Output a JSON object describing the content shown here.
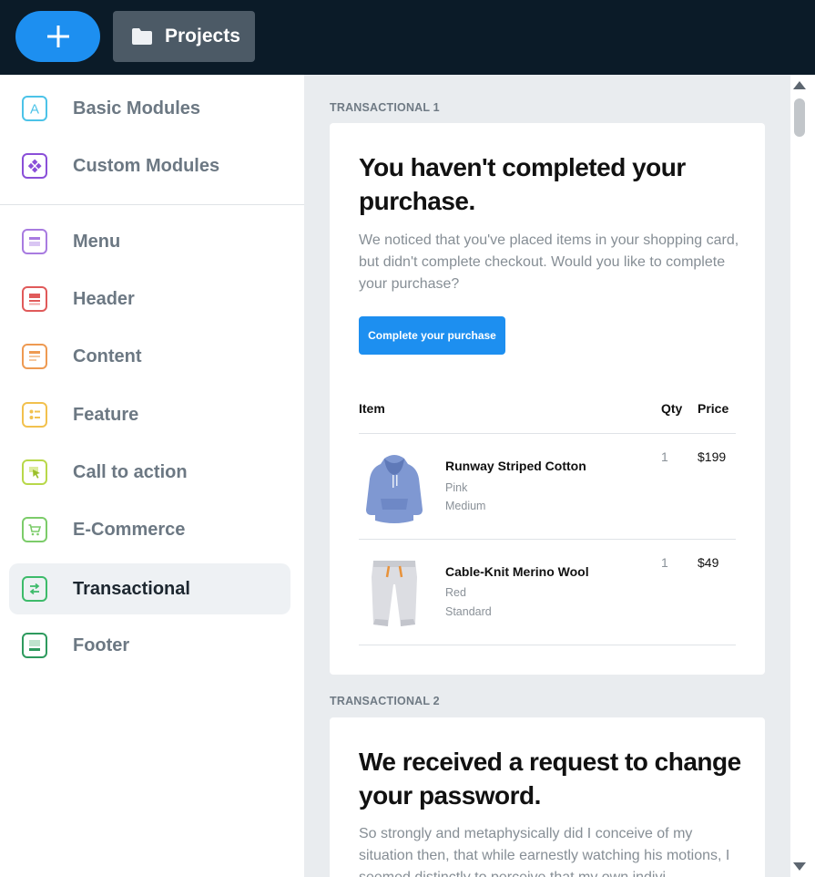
{
  "topbar": {
    "add_icon": "plus-icon",
    "projects_label": "Projects",
    "projects_icon": "folder-icon"
  },
  "sidebar": {
    "items": [
      {
        "label": "Basic Modules",
        "icon": "letter-a-icon",
        "color": "#4cc3e8"
      },
      {
        "label": "Custom Modules",
        "icon": "custom-module-icon",
        "color": "#8a4fd8"
      },
      {
        "label": "Menu",
        "icon": "menu-block-icon",
        "color": "#a87be0"
      },
      {
        "label": "Header",
        "icon": "header-block-icon",
        "color": "#e05a5a"
      },
      {
        "label": "Content",
        "icon": "content-block-icon",
        "color": "#ee9a52"
      },
      {
        "label": "Feature",
        "icon": "feature-block-icon",
        "color": "#f2c14e"
      },
      {
        "label": "Call to action",
        "icon": "cursor-click-icon",
        "color": "#b8d84a"
      },
      {
        "label": "E-Commerce",
        "icon": "cart-icon",
        "color": "#7ccc6a"
      },
      {
        "label": "Transactional",
        "icon": "exchange-icon",
        "color": "#3dbb6a"
      },
      {
        "label": "Footer",
        "icon": "footer-block-icon",
        "color": "#2e9a5e"
      }
    ],
    "active": "Transactional"
  },
  "main": {
    "sections": [
      {
        "label": "TRANSACTIONAL 1",
        "heading": "You haven't completed your purchase.",
        "body": "We noticed that you've placed items in your shopping card, but didn't complete checkout. Would you like to complete your purchase?",
        "button": "Complete your purchase",
        "table_headers": {
          "item": "Item",
          "qty": "Qty",
          "price": "Price"
        },
        "products": [
          {
            "name": "Runway Striped Cotton",
            "color": "Pink",
            "size": "Medium",
            "qty": "1",
            "price": "$199",
            "image": "hoodie-image"
          },
          {
            "name": "Cable-Knit Merino Wool",
            "color": "Red",
            "size": "Standard",
            "qty": "1",
            "price": "$49",
            "image": "sweatpants-image"
          }
        ]
      },
      {
        "label": "TRANSACTIONAL 2",
        "heading": "We received a request to change your password.",
        "body": "So strongly and metaphysically did I conceive of my situation then, that while earnestly watching his motions, I seemed distinctly to perceive that my own indivi"
      }
    ]
  },
  "colors": {
    "topbar_bg": "#0b1b28",
    "accent": "#1d8ff0",
    "projects_bg": "#4c5a66",
    "main_bg": "#e9ecef"
  }
}
